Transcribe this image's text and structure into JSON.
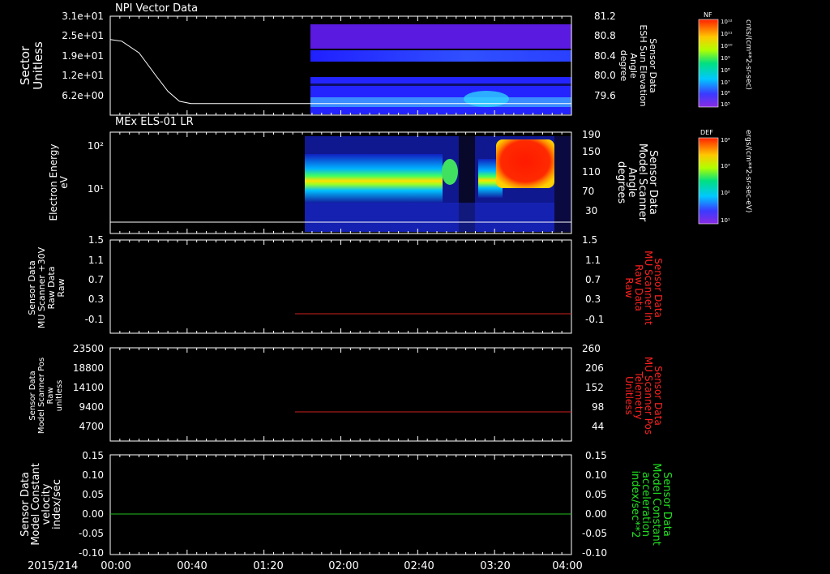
{
  "colors": {
    "background": "#000000",
    "axis": "#ffffff",
    "panel3_right": "#ff2020",
    "panel4_right": "#ff2020",
    "panel5_right": "#20e020",
    "red_trace": "#d02020",
    "green_trace": "#20c020"
  },
  "time_axis": {
    "date": "2015/214",
    "ticks": [
      "00:00",
      "00:40",
      "01:20",
      "02:00",
      "02:40",
      "03:20",
      "04:00"
    ]
  },
  "panels": [
    {
      "title": "NPI Vector Data",
      "left_label": [
        "Sector",
        "Unitless"
      ],
      "left_ticks": [
        "3.1e+01",
        "2.5e+01",
        "1.9e+01",
        "1.2e+01",
        "6.2e+00"
      ],
      "right_label": [
        "Sensor Data",
        "ESH Sun Elevation",
        "Angle",
        "degree"
      ],
      "right_ticks": [
        "81.2",
        "80.8",
        "80.4",
        "80.0",
        "79.6"
      ],
      "colorbar_title": "NF",
      "colorbar_ticks": [
        "10¹²",
        "10¹¹",
        "10¹⁰",
        "10⁹",
        "10⁸",
        "10⁷",
        "10⁶",
        "10⁵"
      ],
      "colorbar_units": "cnts/(cm**2-sr-sec)"
    },
    {
      "title": "MEx ELS-01 LR",
      "left_label": [
        "Electron Energy",
        "eV"
      ],
      "left_ticks": [
        "10²",
        "10¹"
      ],
      "right_label": [
        "Sensor Data",
        "Model Scanner",
        "Angle",
        "degrees"
      ],
      "right_ticks": [
        "190",
        "150",
        "110",
        "70",
        "30"
      ],
      "colorbar_title": "DEF",
      "colorbar_ticks": [
        "10⁴",
        "10³",
        "10²",
        "10¹"
      ],
      "colorbar_units": "ergs/(cm**2-sr-sec-eV)"
    },
    {
      "left_label": [
        "Sensor Data",
        "MU Scanner +30V",
        "Raw Data",
        "Raw"
      ],
      "left_ticks": [
        "1.5",
        "1.1",
        "0.7",
        "0.3",
        "-0.1"
      ],
      "right_label": [
        "Sensor Data",
        "MU Scanner Int",
        "Raw Data",
        "Raw"
      ],
      "right_ticks": [
        "1.5",
        "1.1",
        "0.7",
        "0.3",
        "-0.1"
      ]
    },
    {
      "left_label": [
        "Sensor Data",
        "Model Scanner Pos",
        "Raw",
        "unitless"
      ],
      "left_ticks": [
        "23500",
        "18800",
        "14100",
        "9400",
        "4700"
      ],
      "right_label": [
        "Sensor Data",
        "MU Scanner Pos",
        "Telemetry",
        "Unitless"
      ],
      "right_ticks": [
        "260",
        "206",
        "152",
        "98",
        "44"
      ]
    },
    {
      "left_label": [
        "Sensor Data",
        "Model Constant",
        "velocity",
        "index/sec"
      ],
      "left_ticks": [
        "0.15",
        "0.10",
        "0.05",
        "0.00",
        "-0.05",
        "-0.10"
      ],
      "right_label": [
        "Sensor Data",
        "Model Constant",
        "acceleration",
        "index/sec**2"
      ],
      "right_ticks": [
        "0.15",
        "0.10",
        "0.05",
        "0.00",
        "-0.05",
        "-0.10"
      ]
    }
  ],
  "chart_data": {
    "type": "line",
    "x_range": [
      "00:00",
      "04:00"
    ],
    "spectrogram_start": "01:50",
    "panel1_sector_line": {
      "x_hours": [
        0,
        0.1,
        0.25,
        0.4,
        0.5,
        0.6,
        0.7,
        4.0
      ],
      "y": [
        24,
        23.5,
        20,
        13,
        8.5,
        5.5,
        4.8,
        4.8
      ]
    },
    "panel2_flat_line_ev": 1.8,
    "panel3_trace": {
      "x_start_hours": 1.5,
      "x_end_hours": 4.0,
      "value": 0.0
    },
    "panel4_trace": {
      "x_start_hours": 1.5,
      "x_end_hours": 4.0,
      "value": 8200
    },
    "panel5_trace": {
      "x_start_hours": 0.0,
      "x_end_hours": 4.0,
      "value": 0.0
    }
  }
}
